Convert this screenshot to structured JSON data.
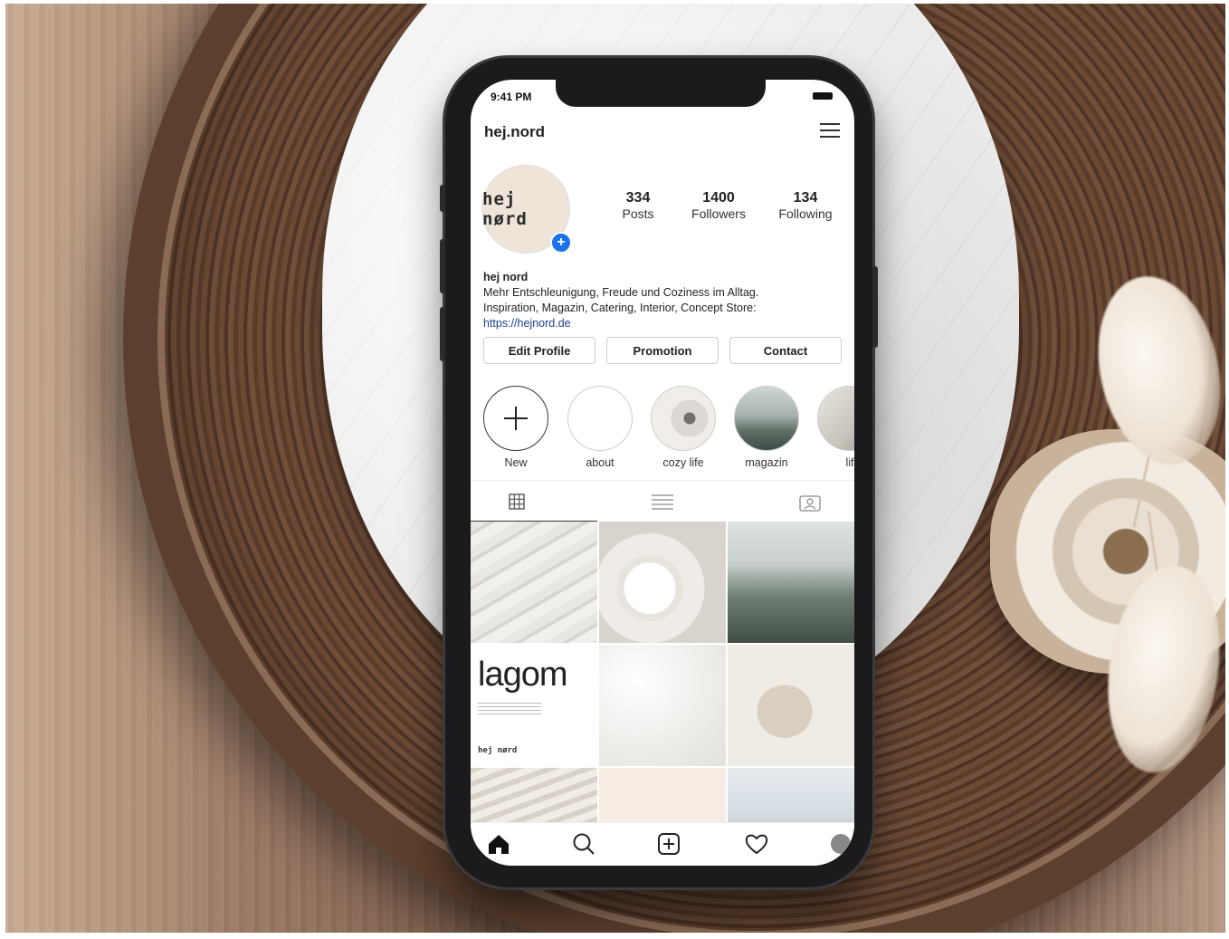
{
  "status_bar": {
    "time": "9:41 PM"
  },
  "profile": {
    "username": "hej.nord",
    "avatar_text": "hej nørd",
    "stats": [
      {
        "value": "334",
        "label": "Posts"
      },
      {
        "value": "1400",
        "label": "Followers"
      },
      {
        "value": "134",
        "label": "Following"
      }
    ],
    "bio": {
      "name": "hej nord",
      "line1": "Mehr Entschleunigung, Freude und Coziness im Alltag.",
      "line2": "Inspiration, Magazin, Catering, Interior, Concept Store:",
      "link": "https://hejnord.de"
    },
    "buttons": {
      "edit": "Edit Profile",
      "promotion": "Promotion",
      "contact": "Contact"
    }
  },
  "highlights": [
    {
      "label": "New"
    },
    {
      "label": "about"
    },
    {
      "label": "cozy life"
    },
    {
      "label": "magazin"
    },
    {
      "label": "lif"
    }
  ],
  "posts": {
    "lagom_title": "lagom",
    "lagom_brand": "hej nørd"
  },
  "colors": {
    "accent": "#1a73e8",
    "link": "#1d3f8f"
  },
  "icons": [
    "menu-icon",
    "add-story-icon",
    "grid-icon",
    "list-icon",
    "tagged-icon",
    "home-icon",
    "search-icon",
    "add-post-icon",
    "heart-icon",
    "profile-icon"
  ]
}
